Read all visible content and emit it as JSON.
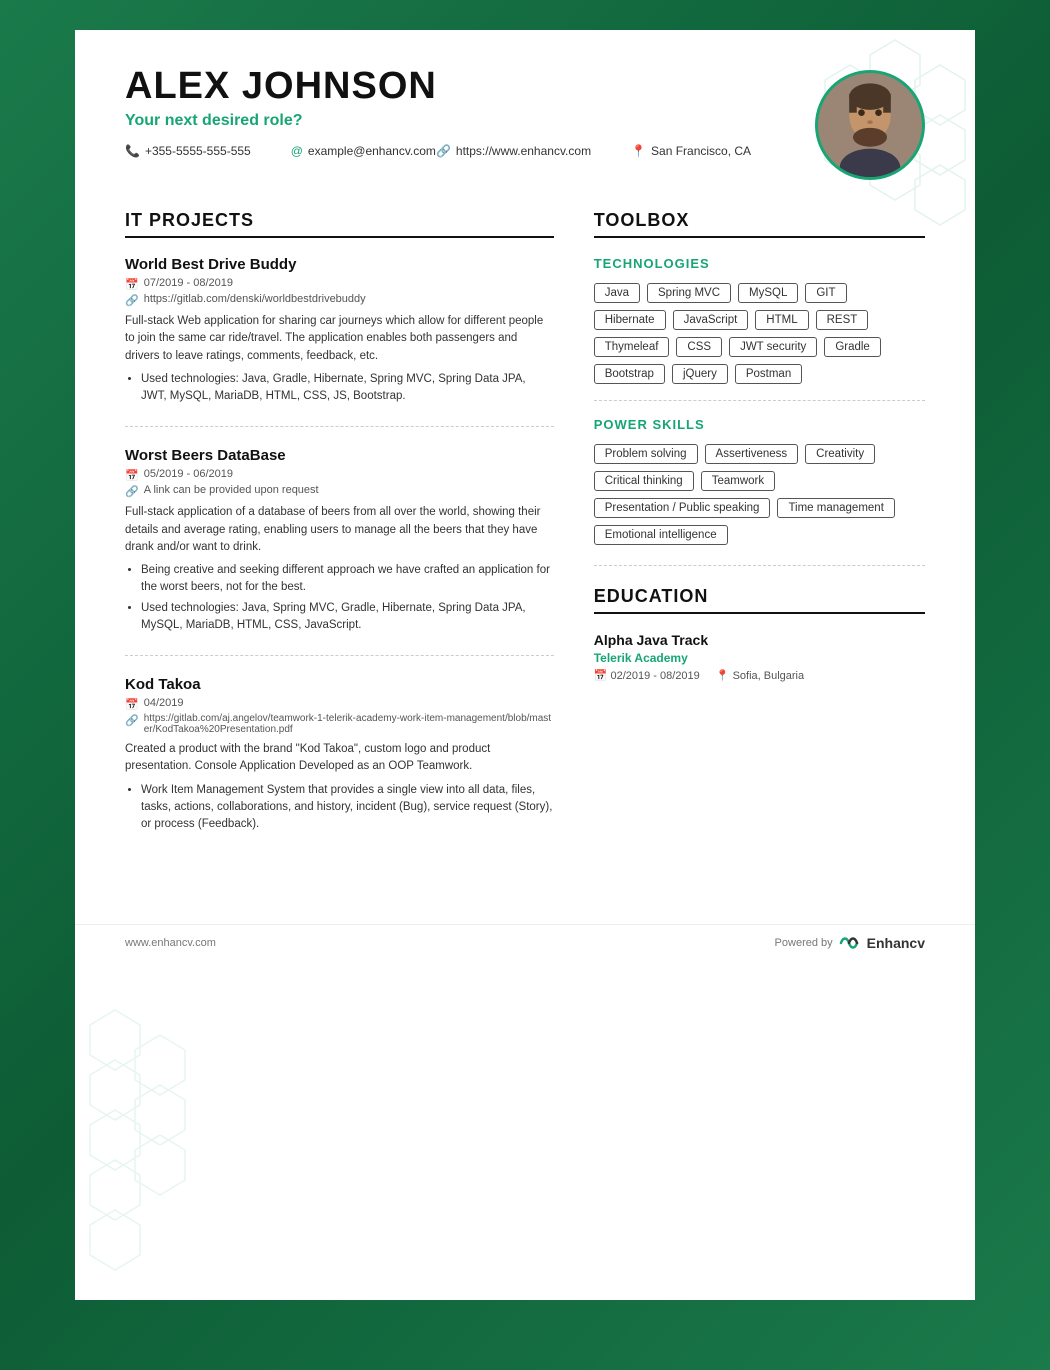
{
  "header": {
    "name": "ALEX JOHNSON",
    "role": "Your next desired role?",
    "phone": "+355-5555-555-555",
    "website": "https://www.enhancv.com",
    "email": "example@enhancv.com",
    "location": "San Francisco, CA"
  },
  "it_projects": {
    "title": "IT PROJECTS",
    "projects": [
      {
        "name": "World Best Drive Buddy",
        "date": "07/2019 - 08/2019",
        "link": "https://gitlab.com/denski/worldbestdrivebuddy",
        "description": "Full-stack Web application for sharing car journeys which allow for different people to join the same car ride/travel. The application enables both passengers and drivers to leave ratings, comments, feedback, etc.",
        "bullets": [
          "Used technologies: Java, Gradle, Hibernate, Spring MVC, Spring Data JPA, JWT, MySQL, MariaDB, HTML, CSS, JS, Bootstrap."
        ]
      },
      {
        "name": "Worst Beers DataBase",
        "date": "05/2019 - 06/2019",
        "link": "A link can be provided upon request",
        "description": "Full-stack application of a database of beers from all over the world, showing their details and average rating, enabling users to manage all the beers that they have drank and/or want to drink.",
        "bullets": [
          "Being creative and seeking different approach we have crafted an application for the worst beers, not for the best.",
          "Used technologies: Java, Spring MVC, Gradle, Hibernate, Spring Data JPA, MySQL, MariaDB, HTML, CSS, JavaScript."
        ]
      },
      {
        "name": "Kod Takoa",
        "date": "04/2019",
        "link": "https://gitlab.com/aj.angelov/teamwork-1-telerik-academy-work-item-management/blob/master/KodTakoa%20Presentation.pdf",
        "description": "Created a product with the brand \"Kod Takoa\", custom logo and product presentation. Console Application Developed as an OOP Teamwork.",
        "bullets": [
          "Work Item Management System that provides a single view into all data, files, tasks, actions, collaborations, and history, incident (Bug), service request (Story), or process (Feedback)."
        ]
      }
    ]
  },
  "toolbox": {
    "title": "TOOLBOX",
    "technologies": {
      "subtitle": "TECHNOLOGIES",
      "tags": [
        "Java",
        "Spring MVC",
        "MySQL",
        "GIT",
        "Hibernate",
        "JavaScript",
        "HTML",
        "REST",
        "Thymeleaf",
        "CSS",
        "JWT security",
        "Gradle",
        "Bootstrap",
        "jQuery",
        "Postman"
      ]
    },
    "power_skills": {
      "subtitle": "POWER SKILLS",
      "tags": [
        "Problem solving",
        "Assertiveness",
        "Creativity",
        "Critical thinking",
        "Teamwork",
        "Presentation / Public speaking",
        "Time management",
        "Emotional intelligence"
      ]
    }
  },
  "education": {
    "title": "EDUCATION",
    "items": [
      {
        "institution": "Alpha Java Track",
        "organization": "Telerik Academy",
        "date": "02/2019 - 08/2019",
        "location": "Sofia, Bulgaria"
      }
    ]
  },
  "footer": {
    "url": "www.enhancv.com",
    "powered_by": "Powered by",
    "brand": "Enhancv"
  }
}
